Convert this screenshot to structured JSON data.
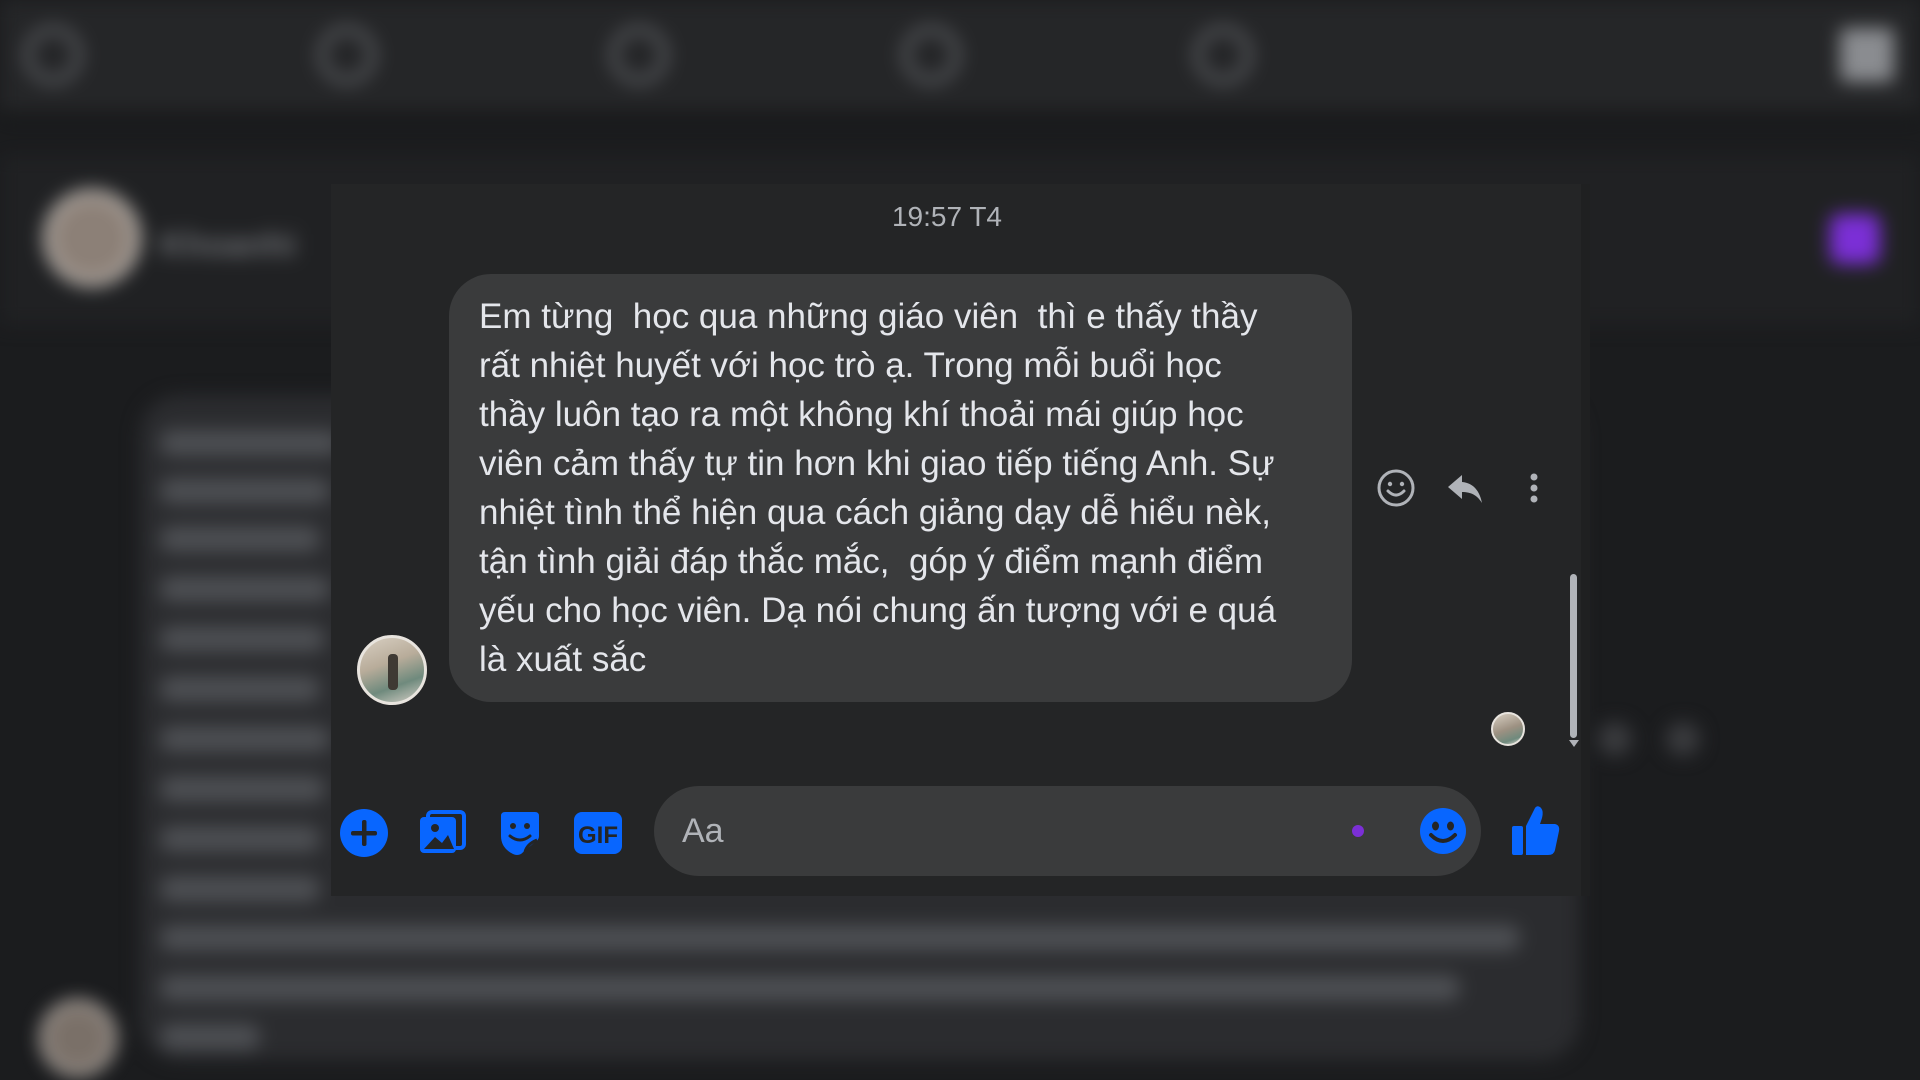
{
  "background": {
    "contact_name": "Khoanhi",
    "nav_icons": [
      "home-icon",
      "groups-icon",
      "watch-icon",
      "marketplace-icon",
      "gaming-icon"
    ]
  },
  "chat": {
    "timestamp": "19:57 T4",
    "message": {
      "text": "Em từng  học qua những giáo viên  thì e thấy thầy\nrất nhiệt huyết với học trò ạ. Trong mỗi buổi học\nthầy luôn tạo ra một không khí thoải mái giúp học\nviên cảm thấy tự tin hơn khi giao tiếp tiếng Anh. Sự\nnhiệt tình thể hiện qua cách giảng dạy dễ hiểu nèk,\ntận tình giải đáp thắc mắc,  góp ý điểm mạnh điểm\nyếu cho học viên. Dạ nói chung ấn tượng với e quá\nlà xuất sắc",
      "actions": [
        "react-icon",
        "reply-icon",
        "more-icon"
      ]
    }
  },
  "composer": {
    "placeholder": "Aa",
    "value": "",
    "tools": [
      "plus-icon",
      "photo-icon",
      "sticker-icon",
      "gif-icon"
    ],
    "gif_label": "GIF"
  },
  "colors": {
    "accent": "#0866ff",
    "typing_dot": "#7b2fd6",
    "panel": "#242526",
    "bubble": "#3a3b3c",
    "text": "#e4e6eb",
    "muted": "#b0b3b8"
  }
}
